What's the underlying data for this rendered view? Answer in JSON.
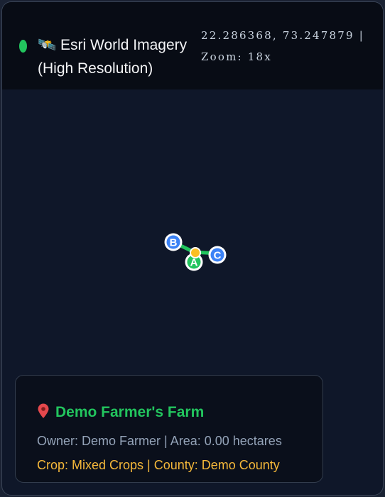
{
  "header": {
    "status_color": "#22c55e",
    "layer_icon": "satellite-icon",
    "layer_icon_glyph": "🛰️",
    "layer_name": "Esri World Imagery (High Resolution)",
    "coordinates": "22.286368, 73.247879",
    "zoom_text": "| Zoom: 18x"
  },
  "map": {
    "markers": [
      {
        "label": "B",
        "name": "marker-b",
        "color": "#3b82f6"
      },
      {
        "label": "A",
        "name": "marker-a",
        "color": "#22c55e"
      },
      {
        "label": "C",
        "name": "marker-c",
        "color": "#3b82f6"
      }
    ],
    "boundary_color": "#22c55e",
    "center_marker_color": "#fbbf24"
  },
  "farm": {
    "pin_icon": "map-pin-icon",
    "title": "Demo Farmer's Farm",
    "owner_line": "Owner: Demo Farmer | Area: 0.00 hectares",
    "crop_line": "Crop: Mixed Crops | County: Demo County"
  }
}
